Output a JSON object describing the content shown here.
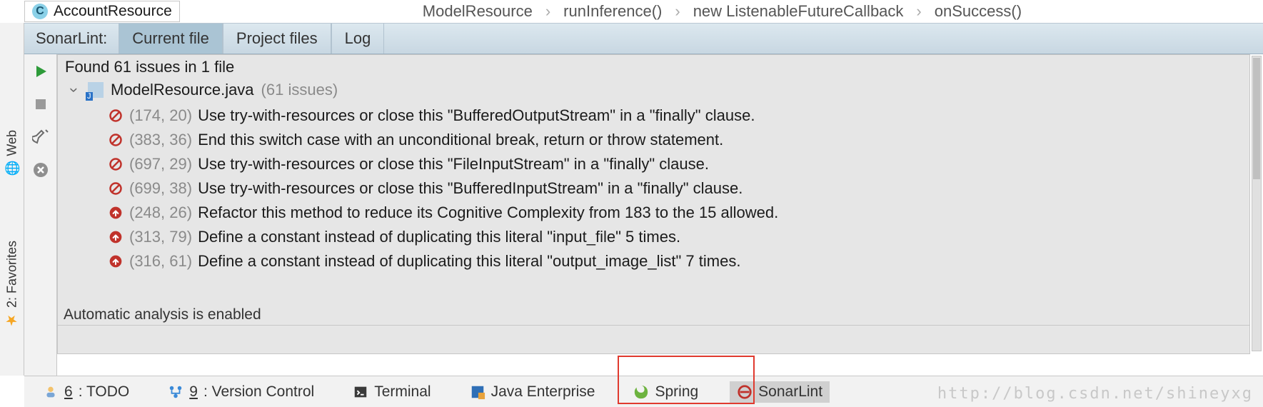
{
  "top": {
    "class_initial": "C",
    "class_name": "AccountResource",
    "breadcrumb": [
      "ModelResource",
      "runInference()",
      "new ListenableFutureCallback",
      "onSuccess()"
    ]
  },
  "tabs": {
    "label": "SonarLint:",
    "items": [
      {
        "label": "Current file",
        "active": true
      },
      {
        "label": "Project files",
        "active": false
      },
      {
        "label": "Log",
        "active": false
      }
    ]
  },
  "left_vert": {
    "web": "Web",
    "favorites": "2: Favorites"
  },
  "panel": {
    "summary": "Found 61 issues in 1 file",
    "file_name": "ModelResource.java",
    "file_issue_count": "(61 issues)",
    "issues": [
      {
        "sev": "block",
        "loc": "(174, 20)",
        "msg": "Use try-with-resources or close this \"BufferedOutputStream\" in a \"finally\" clause."
      },
      {
        "sev": "block",
        "loc": "(383, 36)",
        "msg": "End this switch case with an unconditional break, return or throw statement."
      },
      {
        "sev": "block",
        "loc": "(697, 29)",
        "msg": "Use try-with-resources or close this \"FileInputStream\" in a \"finally\" clause."
      },
      {
        "sev": "block",
        "loc": "(699, 38)",
        "msg": "Use try-with-resources or close this \"BufferedInputStream\" in a \"finally\" clause."
      },
      {
        "sev": "crit",
        "loc": "(248, 26)",
        "msg": "Refactor this method to reduce its Cognitive Complexity from 183 to the 15 allowed."
      },
      {
        "sev": "crit",
        "loc": "(313, 79)",
        "msg": "Define a constant instead of duplicating this literal \"input_file\" 5 times."
      },
      {
        "sev": "crit",
        "loc": "(316, 61)",
        "msg": "Define a constant instead of duplicating this literal \"output_image_list\" 7 times."
      }
    ]
  },
  "status": "Automatic analysis is enabled",
  "bottom": {
    "items": [
      {
        "icon": "todo",
        "pre": "",
        "ukey": "6",
        "label": ": TODO"
      },
      {
        "icon": "vcs",
        "pre": "",
        "ukey": "9",
        "label": ": Version Control"
      },
      {
        "icon": "term",
        "pre": "",
        "ukey": "",
        "label": "Terminal"
      },
      {
        "icon": "jee",
        "pre": "",
        "ukey": "",
        "label": "Java Enterprise"
      },
      {
        "icon": "spring",
        "pre": "",
        "ukey": "",
        "label": "Spring"
      },
      {
        "icon": "sonar",
        "pre": "",
        "ukey": "",
        "label": "SonarLint",
        "selected": true
      }
    ]
  },
  "watermark": "http://blog.csdn.net/shineyxg"
}
